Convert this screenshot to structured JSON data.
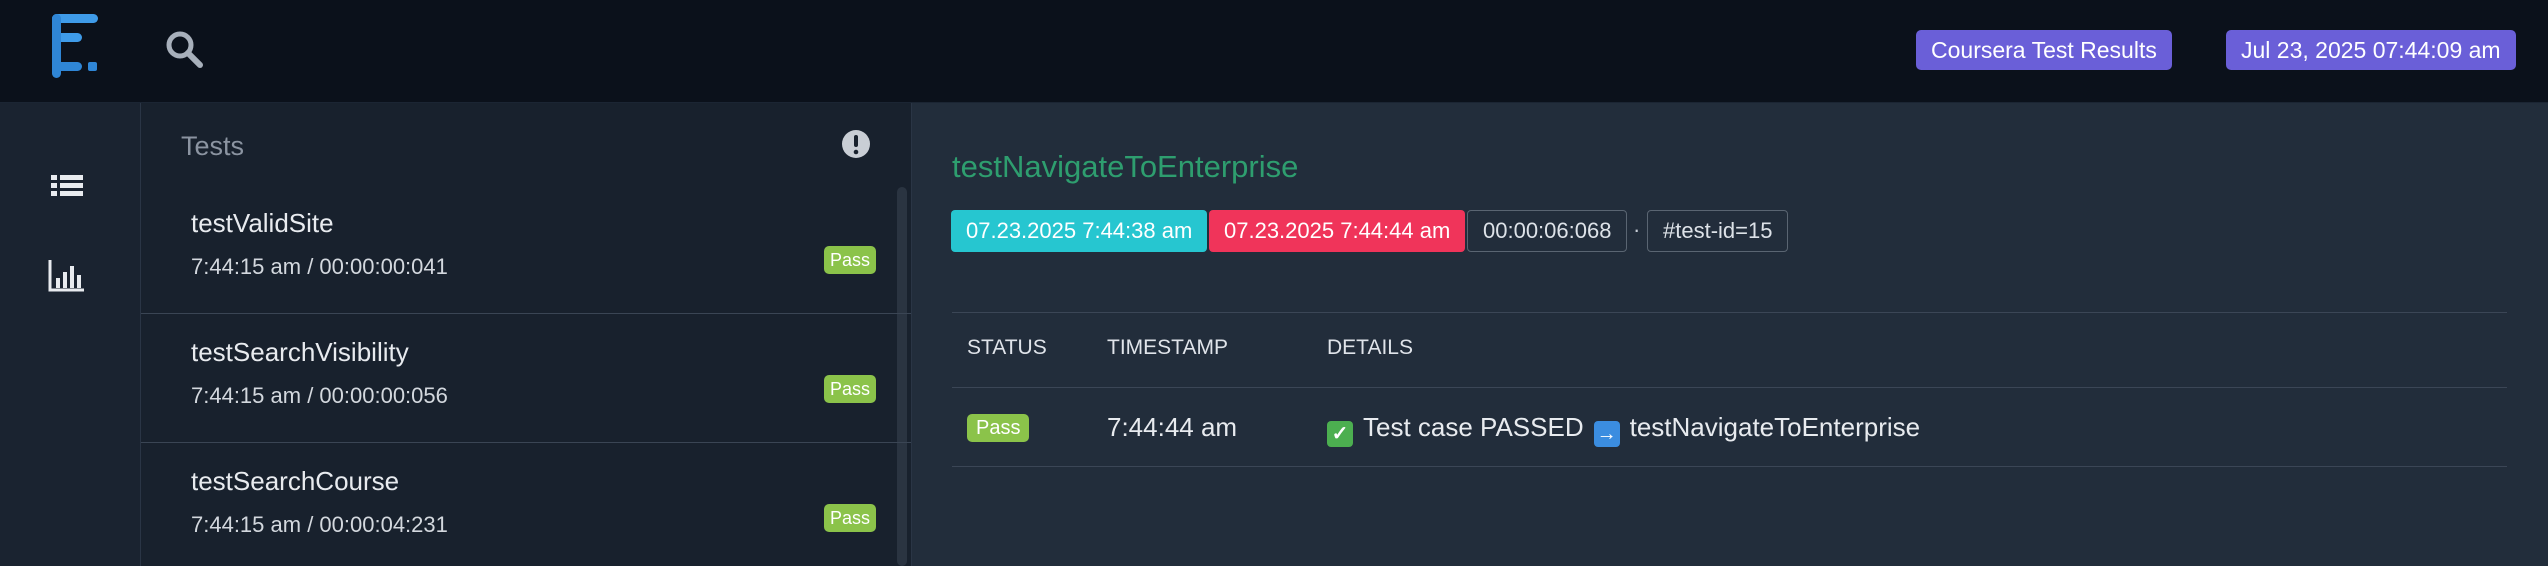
{
  "header": {
    "project_label": "Coursera Test Results",
    "report_date": "Jul 23, 2025 07:44:09 am"
  },
  "icons": {
    "logo": "logo-icon",
    "search": "search-icon",
    "nav_tests": "list-icon",
    "nav_dashboard": "bar-chart-icon",
    "info": "exclamation-circle-icon"
  },
  "colors": {
    "accent_badge": "#6a5fd8",
    "pass": "#8bc34a",
    "start_time": "#26c6d0",
    "end_time": "#f0345a",
    "test_title": "#2e9e6f"
  },
  "tests_panel": {
    "title": "Tests",
    "items": [
      {
        "name": "testValidSite",
        "time": "7:44:15 am / 00:00:00:041",
        "status": "Pass"
      },
      {
        "name": "testSearchVisibility",
        "time": "7:44:15 am / 00:00:00:056",
        "status": "Pass"
      },
      {
        "name": "testSearchCourse",
        "time": "7:44:15 am / 00:00:04:231",
        "status": "Pass"
      }
    ]
  },
  "detail": {
    "title": "testNavigateToEnterprise",
    "start": "07.23.2025 7:44:38 am",
    "end": "07.23.2025 7:44:44 am",
    "duration": "00:00:06:068",
    "separator": "·",
    "test_id": "#test-id=15",
    "table": {
      "headers": [
        "STATUS",
        "TIMESTAMP",
        "DETAILS"
      ],
      "rows": [
        {
          "status": "Pass",
          "timestamp": "7:44:44 am",
          "detail_prefix": "Test case PASSED",
          "detail_suffix": "testNavigateToEnterprise"
        }
      ]
    }
  }
}
